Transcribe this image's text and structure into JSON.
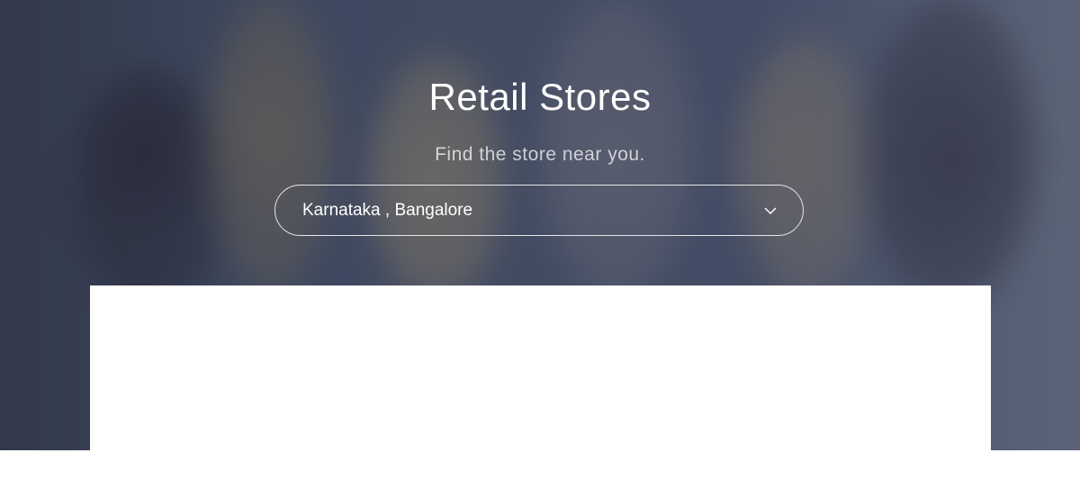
{
  "hero": {
    "title": "Retail Stores",
    "subtitle": "Find the store near you.",
    "overlay_color": "#232a3e"
  },
  "location_select": {
    "selected_value": "Karnataka , Bangalore",
    "icon": "chevron-down-icon"
  },
  "colors": {
    "text": "#ffffff",
    "card": "#ffffff"
  }
}
